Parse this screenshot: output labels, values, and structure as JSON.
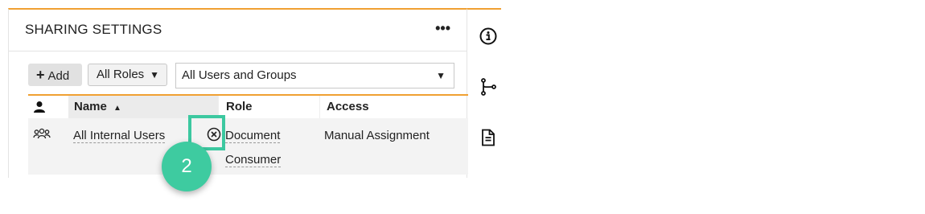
{
  "panel": {
    "title": "SHARING SETTINGS",
    "more_label": "•••"
  },
  "toolbar": {
    "add_label": "Add",
    "roles_filter": "All Roles",
    "users_filter": "All Users and Groups"
  },
  "table": {
    "headers": {
      "name": "Name",
      "role": "Role",
      "access": "Access"
    },
    "rows": [
      {
        "name": "All Internal Users",
        "role_line1": "Document",
        "role_line2": "Consumer",
        "access": "Manual Assignment"
      }
    ]
  },
  "annotation": {
    "step": "2"
  },
  "colors": {
    "accent_orange": "#f0a032",
    "highlight_green": "#3cc8a0"
  },
  "icons": {
    "rail": [
      "info-icon",
      "branch-icon",
      "document-icon"
    ],
    "row": [
      "group-icon",
      "remove-icon"
    ]
  }
}
